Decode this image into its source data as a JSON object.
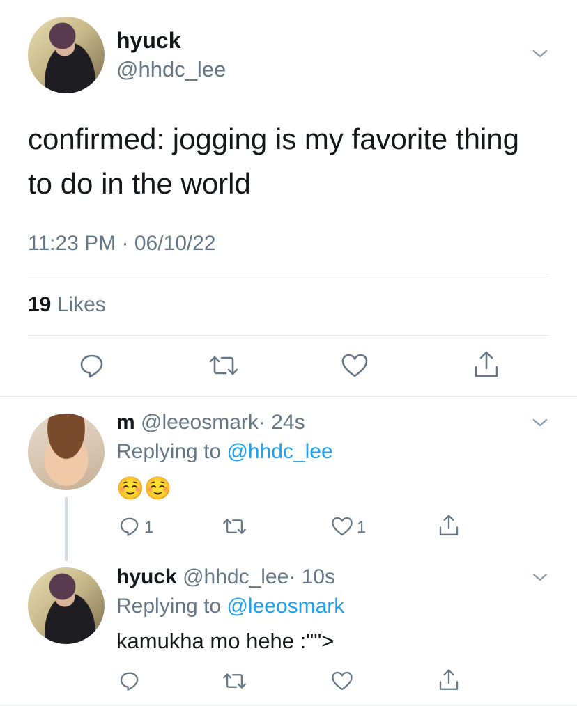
{
  "main_tweet": {
    "display_name": "hyuck",
    "handle": "@hhdc_lee",
    "text_line1": "confirmed: jogging is my favorite thing",
    "text_line2": "to do in the world",
    "timestamp": "11:23 PM · 06/10/22",
    "likes_count": "19",
    "likes_label": "Likes"
  },
  "replies": [
    {
      "display_name": "m",
      "handle": "@leeosmark",
      "time": "· 24s",
      "replying_prefix": "Replying to",
      "replying_to": "@hhdc_lee",
      "text": "☺️☺️",
      "reply_count": "1",
      "like_count": "1"
    },
    {
      "display_name": "hyuck",
      "handle": "@hhdc_lee",
      "time": "· 10s",
      "replying_prefix": "Replying to",
      "replying_to": "@leeosmark",
      "text": "kamukha mo hehe :\"\">"
    }
  ],
  "icons": [
    "chevron-down-icon",
    "reply-icon",
    "retweet-icon",
    "like-icon",
    "share-icon"
  ],
  "colors": {
    "text": "#14171a",
    "secondary": "#657786",
    "link": "#1da1f2",
    "divider": "#e1e8ed"
  }
}
